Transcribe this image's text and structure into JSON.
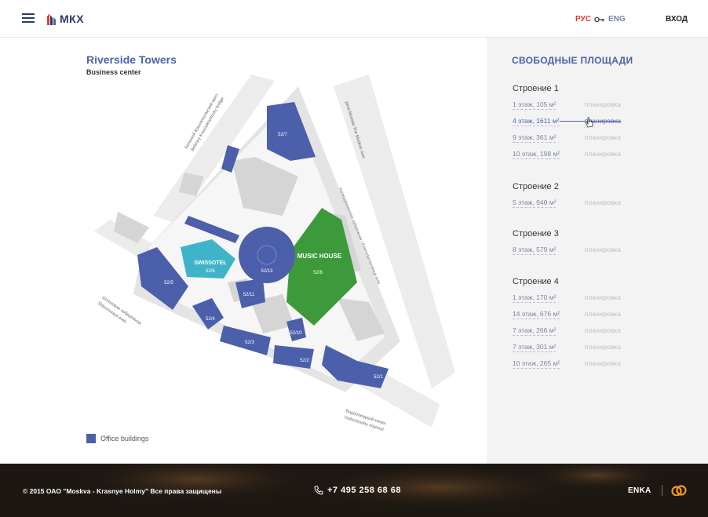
{
  "header": {
    "logo_text": "МКХ",
    "lang_ru": "РУС",
    "lang_en": "ENG",
    "login": "ВХОД"
  },
  "map": {
    "title": "Riverside Towers",
    "subtitle": "Business center",
    "legend": "Office buildings",
    "labels": {
      "b527": "52/7",
      "b5213": "52/13",
      "b528": "52/8",
      "b526": "52/6",
      "b525": "52/5",
      "b5211": "52/11",
      "b524": "52/4",
      "b523": "52/3",
      "b5210": "52/10",
      "b522": "52/2",
      "b521": "52/1",
      "swissotel": "SWISSOTEL",
      "music_house": "MUSIC HOUSE",
      "river": "река Москва The Moskve river",
      "bridge_ru": "Большой Краснохолмский мост",
      "bridge_en": "Bolshoy Krasnokholmsky bridge",
      "emb_kosmo": "Космодамианская набережная / Kosmodamianskaya emb.",
      "emb_shl_ru": "Шлюзовая набережная",
      "emb_shl_en": "Shlyuzovaya emb.",
      "canal_ru": "Водоотводный канал",
      "canal_en": "Vodootvodny channel"
    }
  },
  "sidebar": {
    "title": "СВОБОДНЫЕ ПЛОЩАДИ",
    "plan_label": "планировка",
    "buildings": [
      {
        "name": "Строение 1",
        "rows": [
          "1 этаж, 105 м²",
          "4 этаж, 1611 м²",
          "9 этаж, 361 м²",
          "10 этаж, 198 м²"
        ]
      },
      {
        "name": "Строение 2",
        "rows": [
          "5 этаж, 940 м²"
        ]
      },
      {
        "name": "Строение 3",
        "rows": [
          "8 этаж, 579 м²"
        ]
      },
      {
        "name": "Строение 4",
        "rows": [
          "1 этаж, 170 м²",
          "14 этаж, 676 м²",
          "7 этаж, 266 м²",
          "7 этаж, 301 м²",
          "10 этаж, 265 м²"
        ]
      }
    ]
  },
  "footer": {
    "copyright": "© 2015 ОАО \"Moskva - Krasnye Holmy\" Все права защищены",
    "phone": "+7 495 258 68 68",
    "partner": "ENKA"
  },
  "colors": {
    "accent": "#4a63a8",
    "office": "#4b5fab",
    "green": "#3c9a3a",
    "teal": "#3fb4c8",
    "red": "#e0392b"
  }
}
